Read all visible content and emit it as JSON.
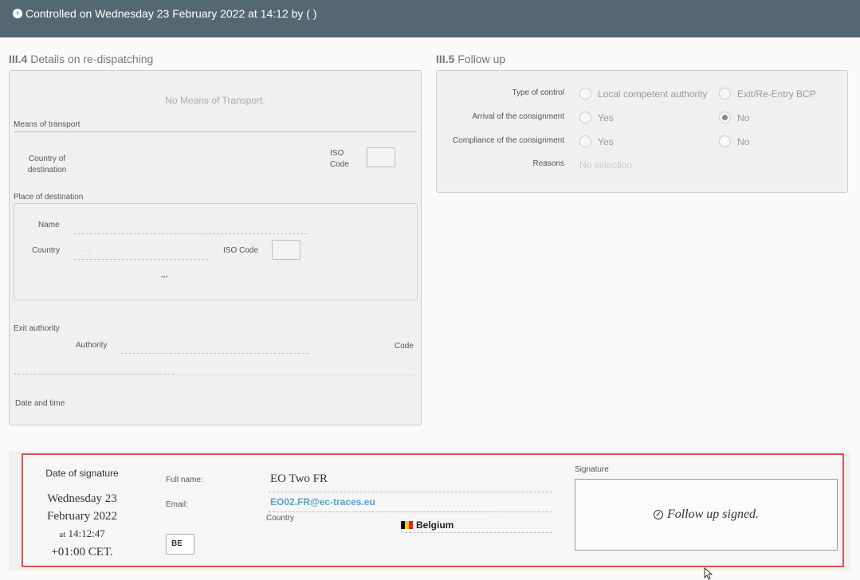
{
  "header": {
    "title": "Controlled on Wednesday 23 February 2022 at 14:12 by ( )"
  },
  "section4": {
    "number": "III.4",
    "title": "Details on re-dispatching",
    "no_transport": "No Means of Transport.",
    "means_of_transport": "Means of transport",
    "country_of_destination_1": "Country of",
    "country_of_destination_2": "destination",
    "iso_code_1": "ISO",
    "iso_code_2": "Code",
    "place_of_destination": "Place of destination",
    "name_label": "Name",
    "country_label": "Country",
    "iso_code_label": "ISO Code",
    "country_placeholder": "----",
    "more": "•••",
    "exit_authority": "Exit authority",
    "authority_label": "Authority",
    "code_label": "Code",
    "date_time": "Date and time"
  },
  "section5": {
    "number": "III.5",
    "title": "Follow up",
    "rows": [
      {
        "label": "Type of control",
        "opt1": "Local competent authority",
        "opt2": "Exit/Re-Entry BCP",
        "selected": null
      },
      {
        "label": "Arrival of the consignment",
        "opt1": "Yes",
        "opt2": "No",
        "selected": 2
      },
      {
        "label": "Compliance of the consignment",
        "opt1": "Yes",
        "opt2": "No",
        "selected": null
      }
    ],
    "reasons_label": "Reasons",
    "reasons_value": "No selection."
  },
  "signature": {
    "date_label": "Date of signature",
    "date_line1": "Wednesday 23",
    "date_line2": "February 2022",
    "time_prefix": "at",
    "time_value": "14:12:47",
    "tz": "+01:00 CET.",
    "full_name_label": "Full name:",
    "full_name": "EO Two FR",
    "email_label": "Email:",
    "email": "EO02.FR@ec-traces.eu",
    "country_label": "Country",
    "country": "Belgium",
    "country_code": "BE",
    "signature_label": "Signature",
    "signed_text": "Follow up signed."
  },
  "colors": {
    "header_bg": "#546873",
    "link": "#5aa0c8",
    "highlight_border": "#d9534f"
  }
}
